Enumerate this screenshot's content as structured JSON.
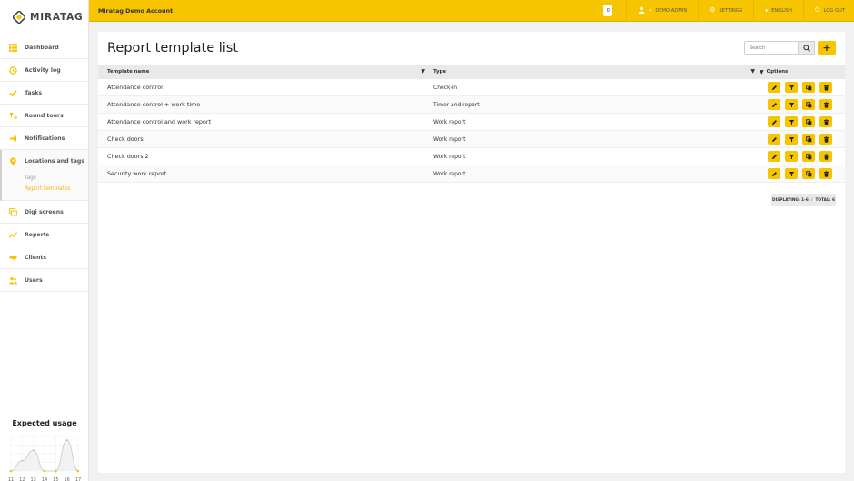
{
  "brand": {
    "name": "MIRATAG"
  },
  "header": {
    "account": "Miratag Demo Account",
    "notification_count": "0",
    "user": "DEMO ADMIN",
    "settings": "SETTINGS",
    "language": "ENGLISH",
    "logout": "LOG OUT",
    "accent_color": "#f7c500"
  },
  "sidebar": {
    "items": [
      {
        "label": "Dashboard",
        "icon": "grid-icon"
      },
      {
        "label": "Activity log",
        "icon": "history-icon"
      },
      {
        "label": "Tasks",
        "icon": "check-icon"
      },
      {
        "label": "Round tours",
        "icon": "route-pin-icon"
      },
      {
        "label": "Notifications",
        "icon": "megaphone-icon"
      },
      {
        "label": "Locations and tags",
        "icon": "map-pin-icon",
        "subitems": [
          "Tags",
          "Report templates"
        ],
        "active_subitem": "Report templates"
      },
      {
        "label": "Digi screens",
        "icon": "screens-icon"
      },
      {
        "label": "Reports",
        "icon": "chart-line-icon"
      },
      {
        "label": "Clients",
        "icon": "handshake-icon"
      },
      {
        "label": "Users",
        "icon": "users-icon"
      }
    ]
  },
  "usage": {
    "title": "Expected usage",
    "x_labels": [
      "11",
      "12",
      "13",
      "14",
      "15",
      "16",
      "17"
    ],
    "values": [
      0,
      2,
      4,
      0,
      0,
      6,
      0
    ]
  },
  "main": {
    "title": "Report template list",
    "search": {
      "placeholder": "Search",
      "value": ""
    },
    "columns": [
      "Template name",
      "Type",
      "Options"
    ],
    "rows": [
      {
        "name": "Attendance control",
        "type": "Check-in"
      },
      {
        "name": "Attendance control + work time",
        "type": "Timer and report"
      },
      {
        "name": "Attendance control and work report",
        "type": "Work report"
      },
      {
        "name": "Check doors",
        "type": "Work report"
      },
      {
        "name": "Check doors 2",
        "type": "Work report"
      },
      {
        "name": "Security work report",
        "type": "Work report"
      }
    ],
    "row_actions": [
      "edit-icon",
      "filter-icon",
      "copy-icon",
      "trash-icon"
    ],
    "pagination": {
      "displaying": "DISPLAYING: 1-6",
      "total": "TOTAL: 6"
    }
  }
}
